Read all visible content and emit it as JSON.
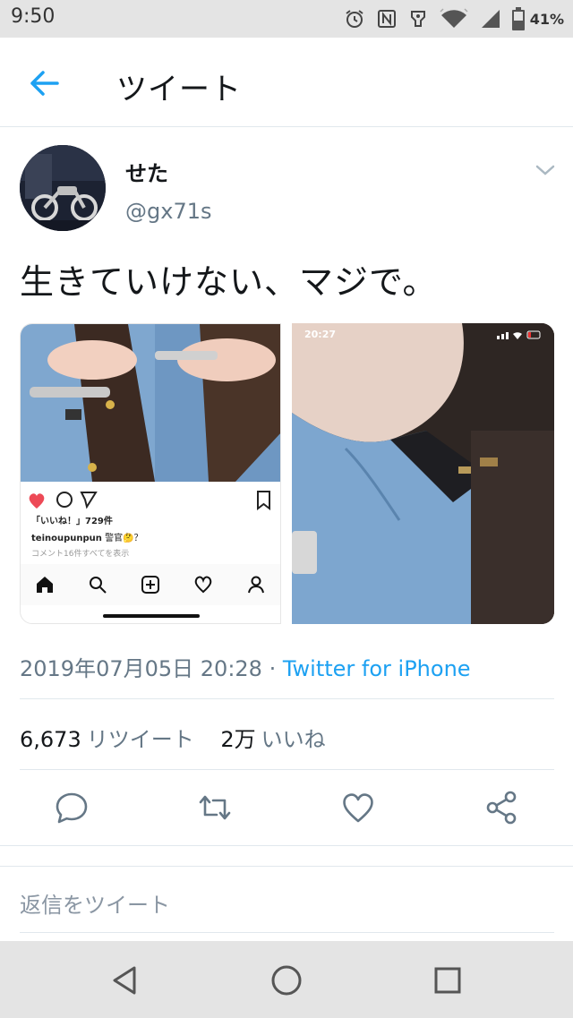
{
  "status_bar": {
    "time": "9:50",
    "battery": "41%"
  },
  "header": {
    "title": "ツイート"
  },
  "tweet": {
    "display_name": "せた",
    "username": "@gx71s",
    "text": "生きていけない、マジで。",
    "timestamp": "2019年07月05日 20:28",
    "separator": " · ",
    "source": "Twitter for iPhone",
    "retweet_count": "6,673",
    "retweet_label": "リツイート",
    "like_count": "2万",
    "like_label": "いいね"
  },
  "media": {
    "left": {
      "likes_text": "「いいね！」729件",
      "caption_user": "teinoupunpun",
      "caption_text": " 警官🤔？",
      "comments_text": "コメント16件すべてを表示"
    },
    "right": {
      "time": "20:27"
    }
  },
  "reply": {
    "placeholder": "返信をツイート"
  },
  "colors": {
    "accent": "#1da1f2",
    "secondary_text": "#657786",
    "heart": "#ed4956"
  },
  "icons": {
    "back": "arrow-left-icon",
    "more": "chevron-down-icon",
    "reply": "reply-icon",
    "retweet": "retweet-icon",
    "like": "heart-icon",
    "share": "share-icon"
  }
}
